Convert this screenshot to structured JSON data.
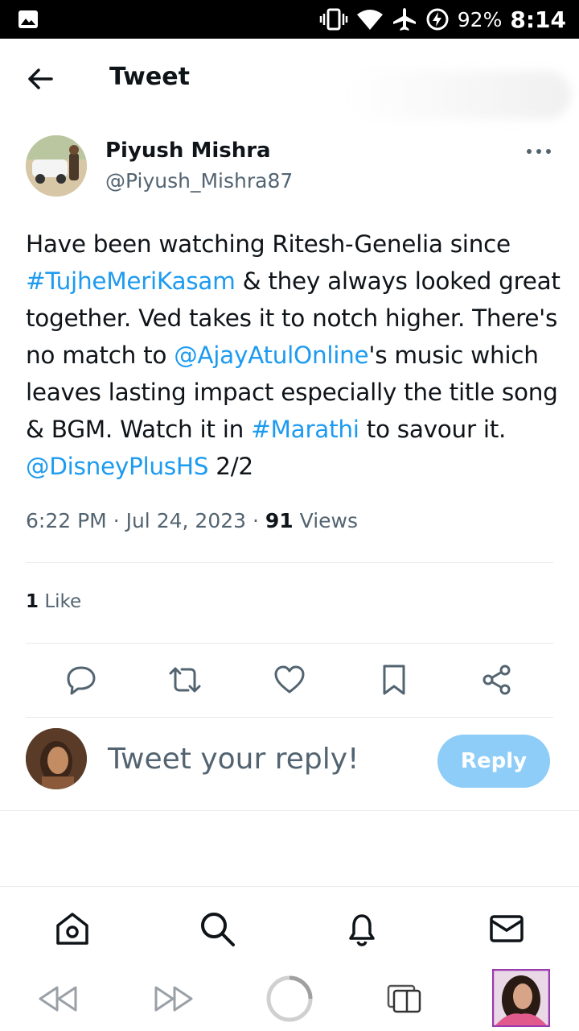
{
  "status_bar": {
    "battery": "92%",
    "time": "8:14"
  },
  "header": {
    "title": "Tweet"
  },
  "tweet": {
    "author_name": "Piyush Mishra",
    "author_handle": "@Piyush_Mishra87",
    "text_parts": [
      {
        "text": "Have been watching Ritesh-Genelia since ",
        "link": false
      },
      {
        "text": "#TujheMeriKasam",
        "link": true
      },
      {
        "text": " & they always looked great together. Ved takes it to notch higher. There's no match to ",
        "link": false
      },
      {
        "text": "@AjayAtulOnline",
        "link": true
      },
      {
        "text": "'s music which leaves lasting impact especially the title song & BGM. Watch it in ",
        "link": false
      },
      {
        "text": "#Marathi",
        "link": true
      },
      {
        "text": " to savour it. ",
        "link": false
      },
      {
        "text": "@DisneyPlusHS",
        "link": true
      },
      {
        "text": " 2/2",
        "link": false
      }
    ],
    "time": "6:22 PM",
    "date": "Jul 24, 2023",
    "views_count": "91",
    "views_label": "Views",
    "likes_count": "1",
    "likes_label": "Like"
  },
  "reply": {
    "placeholder": "Tweet your reply!",
    "button_label": "Reply"
  },
  "colors": {
    "link": "#1d9bf0",
    "reply_button": "#8ecdf8",
    "secondary_text": "#536471"
  },
  "icons": {
    "actions": [
      "reply-icon",
      "retweet-icon",
      "like-icon",
      "bookmark-icon",
      "share-icon"
    ],
    "nav": [
      "home-icon",
      "search-icon",
      "notifications-icon",
      "messages-icon"
    ],
    "browser": [
      "rewind-icon",
      "fast-forward-icon",
      "loading-icon",
      "tabs-icon",
      "profile-thumbnail"
    ]
  }
}
